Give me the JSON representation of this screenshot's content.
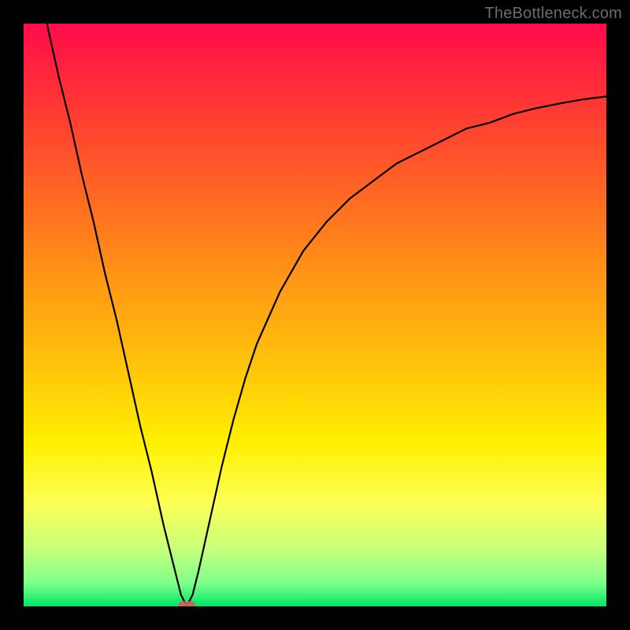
{
  "watermark": "TheBottleneck.com",
  "chart_data": {
    "type": "line",
    "title": "",
    "xlabel": "",
    "ylabel": "",
    "xlim": [
      0,
      100
    ],
    "ylim": [
      0,
      100
    ],
    "grid": false,
    "legend": false,
    "series": [
      {
        "name": "bottleneck-curve",
        "color": "#000000",
        "x": [
          4,
          6,
          8,
          10,
          12,
          14,
          16,
          18,
          20,
          22,
          24,
          26,
          27,
          28,
          29,
          30,
          32,
          34,
          36,
          38,
          40,
          44,
          48,
          52,
          56,
          60,
          64,
          68,
          72,
          76,
          80,
          84,
          88,
          92,
          96,
          100
        ],
        "y": [
          100,
          91,
          83,
          74,
          66,
          57,
          49,
          40,
          31,
          23,
          14,
          6,
          2,
          0,
          2,
          6,
          15,
          24,
          32,
          39,
          45,
          54,
          61,
          66,
          70,
          73,
          76,
          78,
          80,
          82,
          83,
          84.5,
          85.5,
          86.3,
          87,
          87.5
        ]
      }
    ],
    "marker": {
      "name": "minimum-point",
      "x": 28,
      "y": 0,
      "color": "#d85a5a",
      "size": 7
    },
    "colors": {
      "background_gradient_top": "#ff0b4a",
      "background_gradient_bottom": "#00e765",
      "frame": "#000000"
    }
  }
}
